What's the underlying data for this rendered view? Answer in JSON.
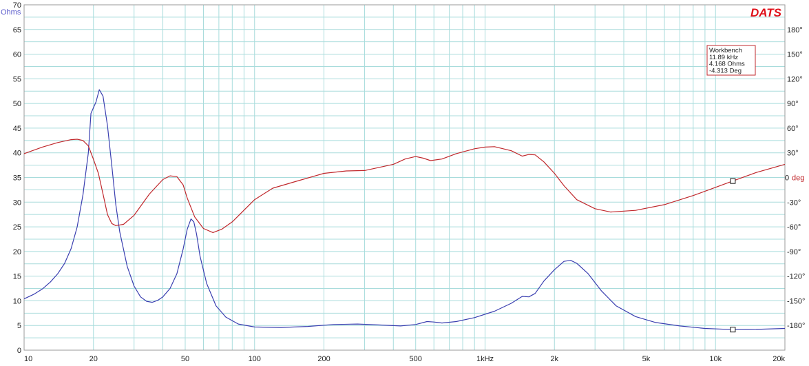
{
  "app": {
    "brand": "DATS"
  },
  "colors": {
    "background": "#ffffff",
    "grid": "#a8dcdc",
    "frame": "#9a9a9a",
    "impedance": "#3a3fb0",
    "phase": "#c0282c",
    "brand": "#e0101a",
    "left_axis_label": "#5a5acb",
    "right_axis_label": "#c0282c"
  },
  "cursor_readout": {
    "title": "Workbench",
    "frequency": "11.89 kHz",
    "impedance": "4.168 Ohms",
    "phase": "-4.313 Deg"
  },
  "chart_data": {
    "type": "line",
    "xscale": "log",
    "xlim": [
      10,
      20000
    ],
    "x_ticks": [
      {
        "value": 10,
        "label": "10"
      },
      {
        "value": 20,
        "label": "20"
      },
      {
        "value": 50,
        "label": "50"
      },
      {
        "value": 100,
        "label": "100"
      },
      {
        "value": 200,
        "label": "200"
      },
      {
        "value": 500,
        "label": "500"
      },
      {
        "value": 1000,
        "label": "1kHz"
      },
      {
        "value": 2000,
        "label": "2k"
      },
      {
        "value": 5000,
        "label": "5k"
      },
      {
        "value": 10000,
        "label": "10k"
      },
      {
        "value": 20000,
        "label": "20k"
      }
    ],
    "y_left": {
      "label": "Ohms",
      "ylim": [
        0,
        70
      ],
      "ticks": [
        {
          "value": 0,
          "label": "0"
        },
        {
          "value": 5,
          "label": "5"
        },
        {
          "value": 10,
          "label": "10"
        },
        {
          "value": 15,
          "label": "15"
        },
        {
          "value": 20,
          "label": "20"
        },
        {
          "value": 25,
          "label": "25"
        },
        {
          "value": 30,
          "label": "30"
        },
        {
          "value": 35,
          "label": "35"
        },
        {
          "value": 40,
          "label": "40"
        },
        {
          "value": 45,
          "label": "45"
        },
        {
          "value": 50,
          "label": "50"
        },
        {
          "value": 55,
          "label": "55"
        },
        {
          "value": 60,
          "label": "60"
        },
        {
          "value": 65,
          "label": "65"
        },
        {
          "value": 70,
          "label": "70"
        }
      ]
    },
    "y_right": {
      "label": "deg",
      "ylim": [
        -210,
        210
      ],
      "ticks": [
        {
          "value": 180,
          "label": "180°"
        },
        {
          "value": 150,
          "label": "150°"
        },
        {
          "value": 120,
          "label": "120°"
        },
        {
          "value": 90,
          "label": "90°"
        },
        {
          "value": 60,
          "label": "60°"
        },
        {
          "value": 30,
          "label": "30°"
        },
        {
          "value": 0,
          "label": "0"
        },
        {
          "value": -30,
          "label": "-30°"
        },
        {
          "value": -60,
          "label": "-60°"
        },
        {
          "value": -90,
          "label": "-90°"
        },
        {
          "value": -120,
          "label": "-120°"
        },
        {
          "value": -150,
          "label": "-150°"
        },
        {
          "value": -180,
          "label": "-180°"
        }
      ]
    },
    "grid": true,
    "series": [
      {
        "axis": "left",
        "color": "#3a3fb0",
        "points": [
          [
            10,
            10.4
          ],
          [
            11,
            11.3
          ],
          [
            12,
            12.4
          ],
          [
            13,
            13.8
          ],
          [
            14,
            15.5
          ],
          [
            15,
            17.6
          ],
          [
            16,
            20.6
          ],
          [
            17,
            25.0
          ],
          [
            18,
            31.5
          ],
          [
            19,
            40.0
          ],
          [
            19.5,
            48.0
          ],
          [
            20.5,
            50.3
          ],
          [
            21.2,
            52.8
          ],
          [
            22,
            51.5
          ],
          [
            23,
            45.5
          ],
          [
            24,
            37.5
          ],
          [
            25,
            29.5
          ],
          [
            26,
            24.0
          ],
          [
            28,
            17.0
          ],
          [
            30,
            13.0
          ],
          [
            32,
            10.8
          ],
          [
            34,
            9.9
          ],
          [
            36,
            9.7
          ],
          [
            38,
            10.1
          ],
          [
            40,
            10.8
          ],
          [
            43,
            12.5
          ],
          [
            46,
            15.5
          ],
          [
            49,
            20.5
          ],
          [
            51,
            24.5
          ],
          [
            53,
            26.6
          ],
          [
            54.5,
            26.0
          ],
          [
            56,
            23.5
          ],
          [
            58,
            19.0
          ],
          [
            62,
            13.5
          ],
          [
            68,
            9.0
          ],
          [
            75,
            6.7
          ],
          [
            85,
            5.3
          ],
          [
            100,
            4.7
          ],
          [
            130,
            4.6
          ],
          [
            170,
            4.8
          ],
          [
            220,
            5.2
          ],
          [
            280,
            5.3
          ],
          [
            350,
            5.1
          ],
          [
            430,
            4.9
          ],
          [
            500,
            5.2
          ],
          [
            560,
            5.8
          ],
          [
            600,
            5.7
          ],
          [
            650,
            5.5
          ],
          [
            750,
            5.8
          ],
          [
            900,
            6.6
          ],
          [
            1100,
            7.9
          ],
          [
            1300,
            9.5
          ],
          [
            1450,
            10.9
          ],
          [
            1550,
            10.8
          ],
          [
            1650,
            11.5
          ],
          [
            1800,
            14.0
          ],
          [
            2000,
            16.3
          ],
          [
            2200,
            18.0
          ],
          [
            2350,
            18.2
          ],
          [
            2500,
            17.6
          ],
          [
            2800,
            15.5
          ],
          [
            3200,
            12.0
          ],
          [
            3700,
            9.0
          ],
          [
            4500,
            6.8
          ],
          [
            5500,
            5.6
          ],
          [
            7000,
            4.9
          ],
          [
            9000,
            4.4
          ],
          [
            11890,
            4.17
          ],
          [
            15000,
            4.2
          ],
          [
            20000,
            4.4
          ]
        ]
      },
      {
        "axis": "right",
        "color": "#c0282c",
        "points": [
          [
            10,
            29.0
          ],
          [
            12,
            37.0
          ],
          [
            14,
            42.5
          ],
          [
            16,
            46.0
          ],
          [
            17,
            46.5
          ],
          [
            18,
            45.0
          ],
          [
            19,
            38.5
          ],
          [
            20,
            22.0
          ],
          [
            21,
            5.0
          ],
          [
            22,
            -20.0
          ],
          [
            23,
            -45.0
          ],
          [
            24,
            -56.0
          ],
          [
            25,
            -58.5
          ],
          [
            27,
            -57.0
          ],
          [
            30,
            -46.0
          ],
          [
            35,
            -20.0
          ],
          [
            40,
            -2.5
          ],
          [
            43,
            2.0
          ],
          [
            46,
            1.0
          ],
          [
            49,
            -9.0
          ],
          [
            51,
            -25.0
          ],
          [
            55,
            -48.0
          ],
          [
            60,
            -62.0
          ],
          [
            66,
            -67.0
          ],
          [
            72,
            -63.0
          ],
          [
            80,
            -54.0
          ],
          [
            100,
            -27.0
          ],
          [
            120,
            -13.0
          ],
          [
            150,
            -5.0
          ],
          [
            200,
            5.0
          ],
          [
            250,
            8.0
          ],
          [
            300,
            8.5
          ],
          [
            400,
            16.0
          ],
          [
            450,
            22.5
          ],
          [
            500,
            25.5
          ],
          [
            540,
            23.5
          ],
          [
            580,
            20.5
          ],
          [
            650,
            22.5
          ],
          [
            750,
            29.0
          ],
          [
            900,
            35.0
          ],
          [
            1000,
            37.0
          ],
          [
            1100,
            37.5
          ],
          [
            1300,
            32.5
          ],
          [
            1450,
            26.0
          ],
          [
            1550,
            28.0
          ],
          [
            1650,
            27.5
          ],
          [
            1800,
            19.0
          ],
          [
            2000,
            5.0
          ],
          [
            2200,
            -10.0
          ],
          [
            2500,
            -27.0
          ],
          [
            3000,
            -38.0
          ],
          [
            3500,
            -42.0
          ],
          [
            4500,
            -40.0
          ],
          [
            6000,
            -33.0
          ],
          [
            8000,
            -22.0
          ],
          [
            11890,
            -4.3
          ],
          [
            15000,
            6.0
          ],
          [
            20000,
            16.0
          ]
        ]
      }
    ],
    "cursors": [
      {
        "axis": "left",
        "x": 11890,
        "y": 4.168
      },
      {
        "axis": "right",
        "x": 11890,
        "y": -4.313
      }
    ]
  }
}
